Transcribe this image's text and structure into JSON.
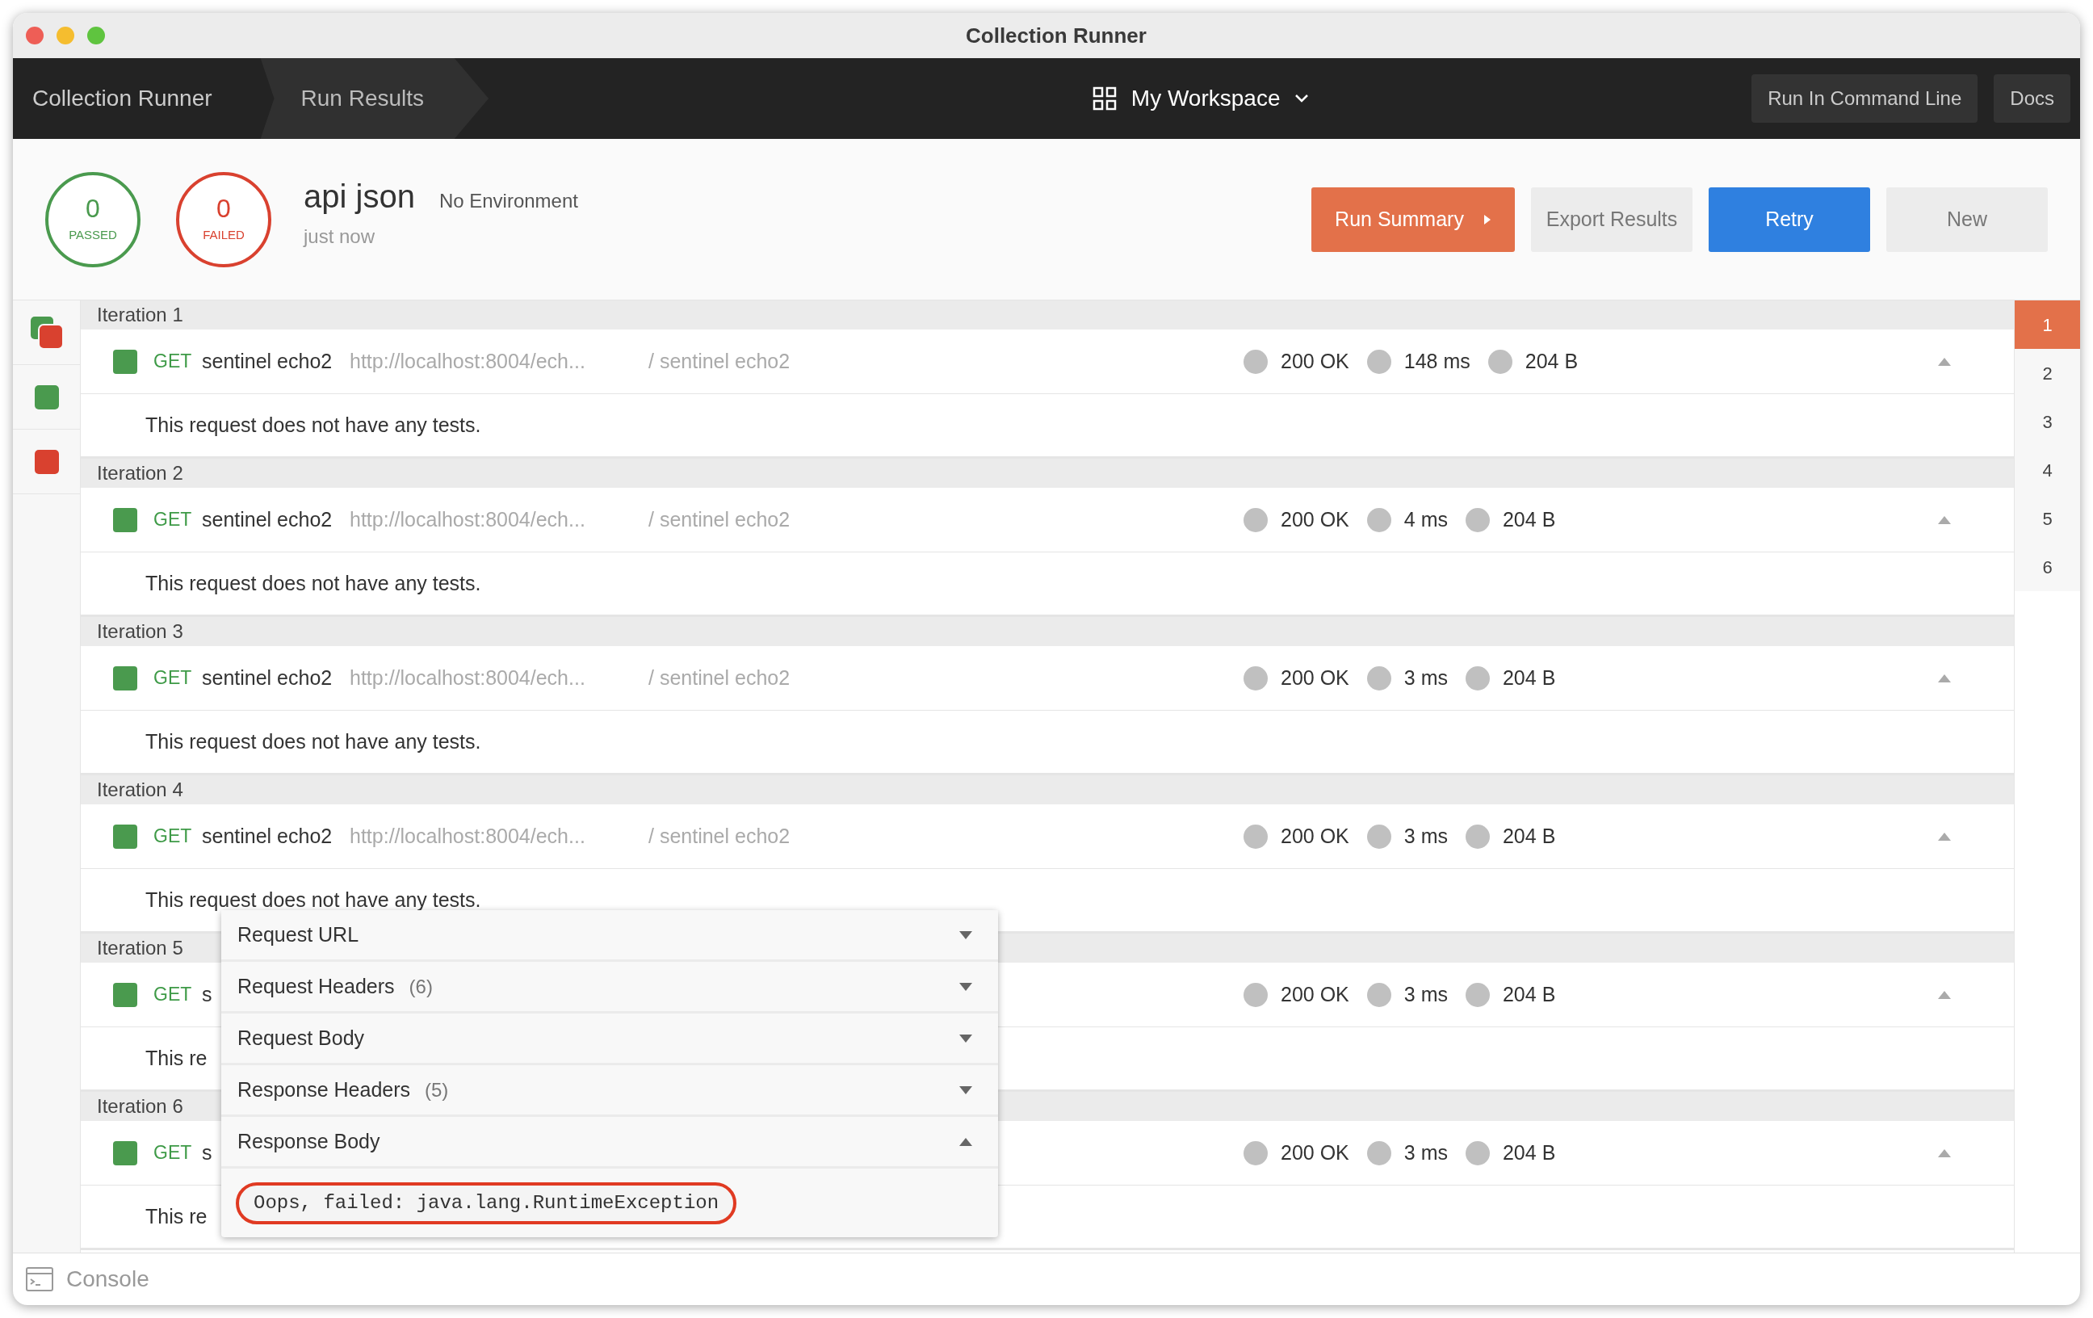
{
  "window": {
    "title": "Collection Runner"
  },
  "nav": {
    "tabs": [
      {
        "label": "Collection Runner",
        "selected": false
      },
      {
        "label": "Run Results",
        "selected": true
      }
    ],
    "workspace": "My Workspace",
    "buttons": [
      "Run In Command Line",
      "Docs"
    ]
  },
  "summary": {
    "stats": [
      {
        "kind": "passed",
        "count": "0",
        "label": "PASSED"
      },
      {
        "kind": "failed",
        "count": "0",
        "label": "FAILED"
      }
    ],
    "collection": "api json",
    "environment": "No Environment",
    "time": "just now",
    "buttons": [
      {
        "label": "Run Summary",
        "kind": "summary"
      },
      {
        "label": "Export Results",
        "kind": "secondary"
      },
      {
        "label": "Retry",
        "kind": "primary"
      },
      {
        "label": "New",
        "kind": "plain"
      }
    ]
  },
  "filters": [
    {
      "kind": "all"
    },
    {
      "kind": "passed"
    },
    {
      "kind": "failed"
    }
  ],
  "iterations": [
    {
      "label": "Iteration 1",
      "request": {
        "color": "#4a9a4e",
        "method": "GET",
        "name": "sentinel echo2",
        "url": "http://localhost:8004/ech...",
        "path": "/ sentinel echo2",
        "code": "200 OK",
        "time": "148 ms",
        "size": "204 B"
      },
      "tests": "This request does not have any tests."
    },
    {
      "label": "Iteration 2",
      "request": {
        "color": "#4a9a4e",
        "method": "GET",
        "name": "sentinel echo2",
        "url": "http://localhost:8004/ech...",
        "path": "/ sentinel echo2",
        "code": "200 OK",
        "time": "4 ms",
        "size": "204 B"
      },
      "tests": "This request does not have any tests."
    },
    {
      "label": "Iteration 3",
      "request": {
        "color": "#4a9a4e",
        "method": "GET",
        "name": "sentinel echo2",
        "url": "http://localhost:8004/ech...",
        "path": "/ sentinel echo2",
        "code": "200 OK",
        "time": "3 ms",
        "size": "204 B"
      },
      "tests": "This request does not have any tests."
    },
    {
      "label": "Iteration 4",
      "request": {
        "color": "#4a9a4e",
        "method": "GET",
        "name": "sentinel echo2",
        "url": "http://localhost:8004/ech...",
        "path": "/ sentinel echo2",
        "code": "200 OK",
        "time": "3 ms",
        "size": "204 B"
      },
      "tests": "This request does not have any tests."
    },
    {
      "label": "Iteration 5",
      "request": {
        "color": "#4a9a4e",
        "method": "GET",
        "name": "s",
        "code": "200 OK",
        "time": "3 ms",
        "size": "204 B"
      },
      "tests": "This re"
    },
    {
      "label": "Iteration 6",
      "request": {
        "color": "#4a9a4e",
        "method": "GET",
        "name": "s",
        "code": "200 OK",
        "time": "3 ms",
        "size": "204 B"
      },
      "tests": "This re"
    }
  ],
  "pager": [
    {
      "label": "1",
      "selected": true
    },
    {
      "label": "2",
      "selected": false
    },
    {
      "label": "3",
      "selected": false
    },
    {
      "label": "4",
      "selected": false
    },
    {
      "label": "5",
      "selected": false
    },
    {
      "label": "6",
      "selected": false
    }
  ],
  "popup": {
    "sections": [
      {
        "title": "Request URL",
        "expanded": false
      },
      {
        "title": "Request Headers",
        "count": "(6)",
        "expanded": false
      },
      {
        "title": "Request Body",
        "expanded": false
      },
      {
        "title": "Response Headers",
        "count": "(5)",
        "expanded": false
      },
      {
        "title": "Response Body",
        "expanded": true,
        "body": "Oops, failed: java.lang.RuntimeException"
      }
    ]
  },
  "console": {
    "label": "Console"
  }
}
